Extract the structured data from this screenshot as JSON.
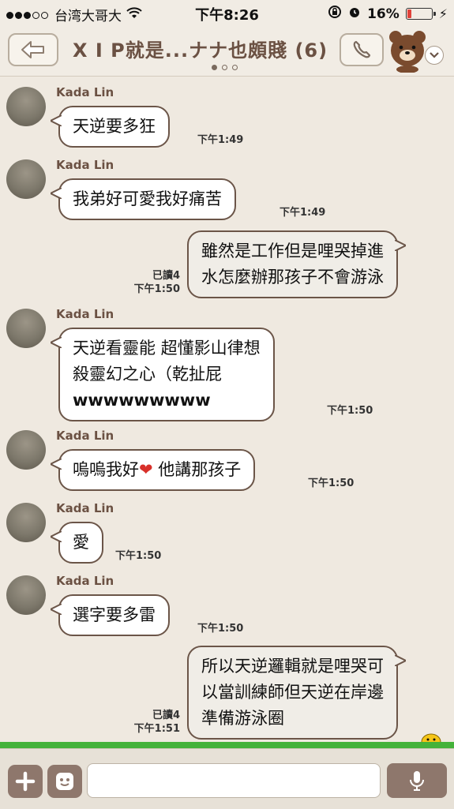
{
  "status_bar": {
    "carrier": "台湾大哥大",
    "time": "下午8:26",
    "battery": "16%",
    "battery_level": 0.16
  },
  "header": {
    "title": "X I P就是...ナナ也頗賤 (6)",
    "page_indicator": {
      "count": 3,
      "active": 0
    },
    "back_icon": "back-arrow-icon",
    "call_icon": "phone-icon"
  },
  "messages": [
    {
      "sender": "Kada Lin",
      "text": [
        "天逆要多狂"
      ],
      "time": "下午1:49"
    },
    {
      "sender": "Kada Lin",
      "text": [
        "我弟好可愛我好痛苦"
      ],
      "time": "下午1:49"
    },
    {
      "read": "已讀4",
      "text": [
        "雖然是工作但是哩哭掉進",
        "水怎麼辦那孩子不會游泳"
      ],
      "time": "下午1:50"
    },
    {
      "sender": "Kada Lin",
      "text": [
        "天逆看靈能 超懂影山律想",
        "殺靈幻之心（乾扯屁",
        "wwwwwwwww"
      ],
      "time": "下午1:50"
    },
    {
      "sender": "Kada Lin",
      "text_before": "嗚嗚我好",
      "heart": "❤",
      "text_after": " 他講那孩子",
      "time": "下午1:50"
    },
    {
      "sender": "Kada Lin",
      "text": [
        "愛"
      ],
      "time": "下午1:50"
    },
    {
      "sender": "Kada Lin",
      "text": [
        "選字要多雷"
      ],
      "time": "下午1:50"
    },
    {
      "read": "已讀4",
      "text": [
        "所以天逆邏輯就是哩哭可",
        "以當訓練師但天逆在岸邊",
        "準備游泳圈"
      ],
      "time": "下午1:51"
    }
  ],
  "colors": {
    "background": "#efe9e0",
    "bubble_border": "#6b5548",
    "accent_brown": "#8e776c",
    "sender_text": "#6b5143",
    "strip_green": "#44b23a"
  },
  "input": {
    "value": "",
    "placeholder": ""
  }
}
